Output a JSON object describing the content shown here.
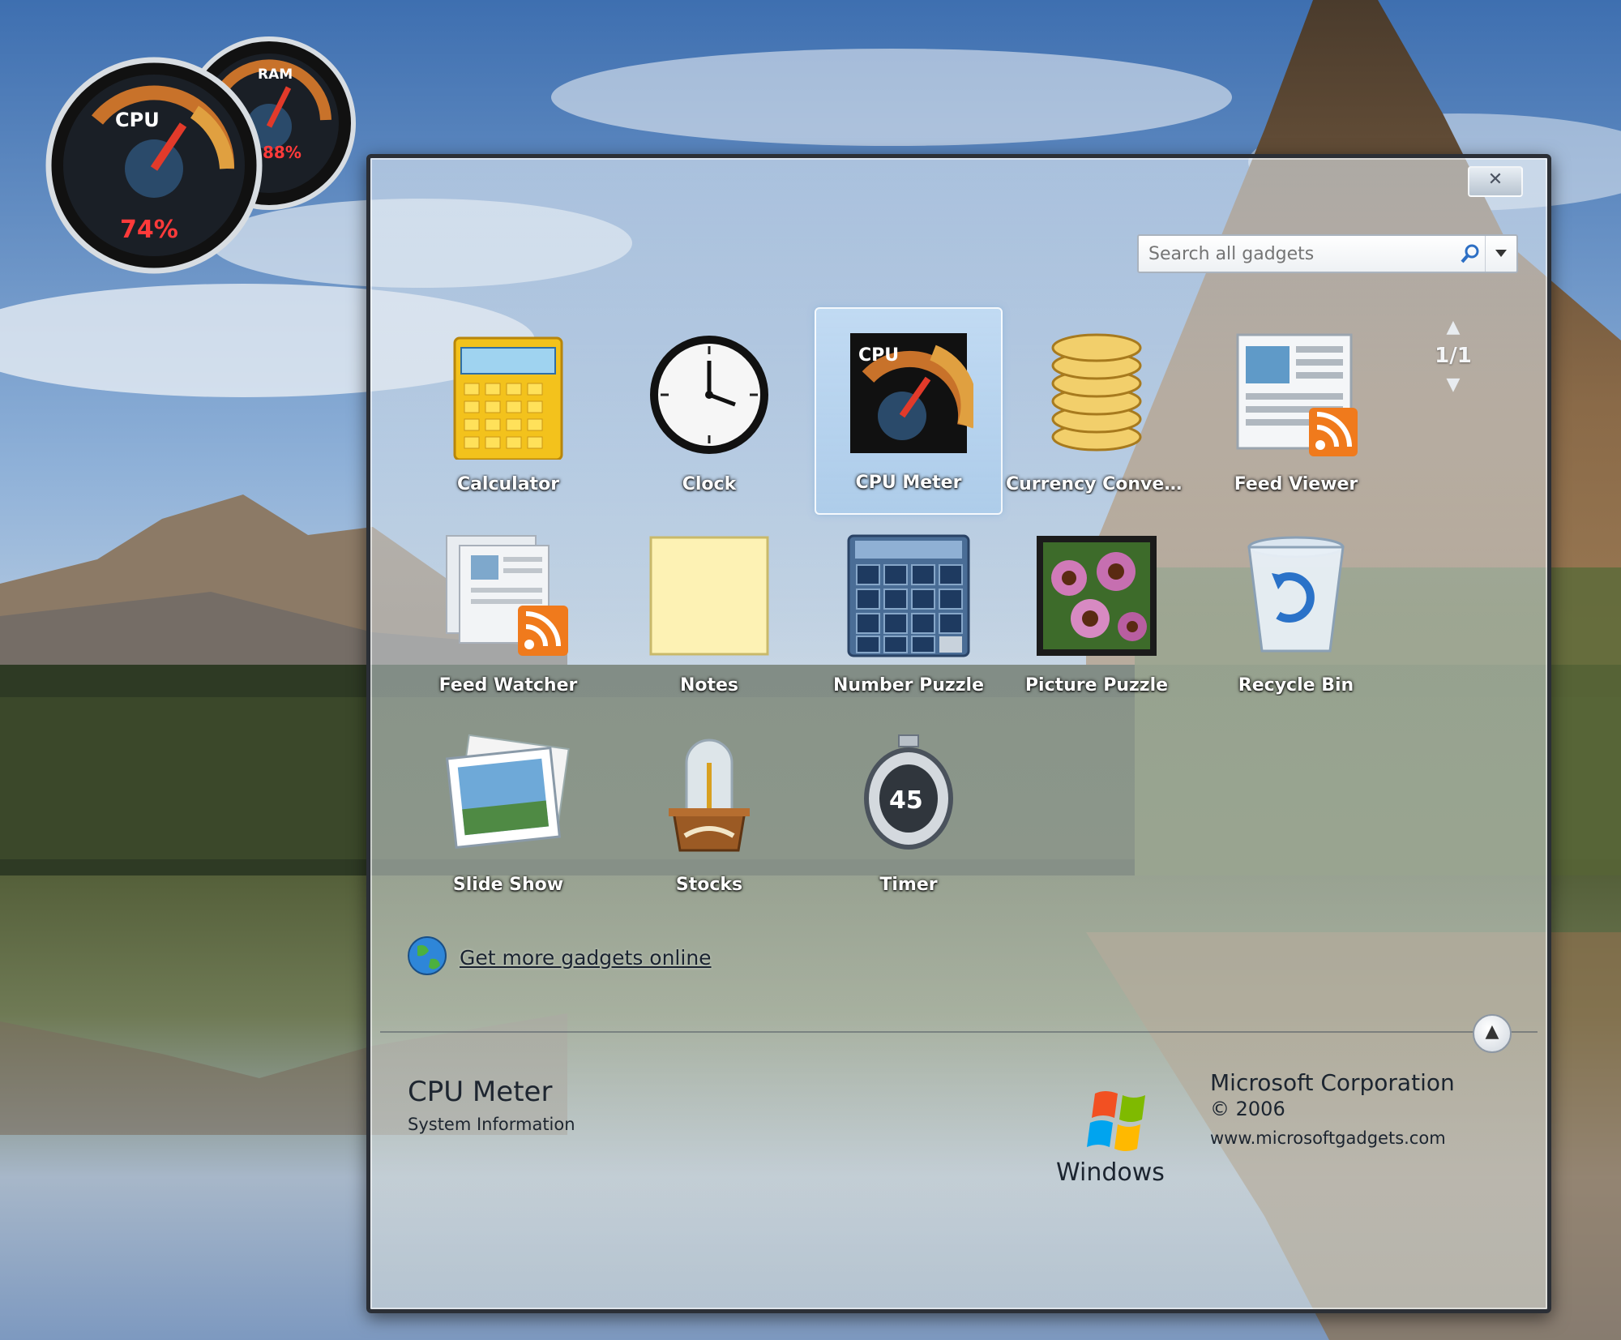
{
  "desktop": {
    "cpu_gadget": {
      "label_large": "CPU",
      "value_large": "74%",
      "label_small": "RAM",
      "value_small": "88%"
    }
  },
  "gallery": {
    "close_label": "✕",
    "search": {
      "placeholder": "Search all gadgets"
    },
    "pager": {
      "text": "1/1",
      "up": "▲",
      "down": "▼"
    },
    "gadgets": [
      {
        "label": "Calculator",
        "icon": "calculator-icon"
      },
      {
        "label": "Clock",
        "icon": "clock-icon"
      },
      {
        "label": "CPU Meter",
        "icon": "cpu-meter-icon",
        "selected": true
      },
      {
        "label": "Currency Conversi...",
        "icon": "currency-icon"
      },
      {
        "label": "Feed Viewer",
        "icon": "feed-viewer-icon"
      },
      {
        "label": "Feed Watcher",
        "icon": "feed-watcher-icon"
      },
      {
        "label": "Notes",
        "icon": "notes-icon"
      },
      {
        "label": "Number Puzzle",
        "icon": "number-puzzle-icon"
      },
      {
        "label": "Picture Puzzle",
        "icon": "picture-puzzle-icon"
      },
      {
        "label": "Recycle Bin",
        "icon": "recycle-bin-icon"
      },
      {
        "label": "Slide Show",
        "icon": "slide-show-icon"
      },
      {
        "label": "Stocks",
        "icon": "stocks-icon"
      },
      {
        "label": "Timer",
        "icon": "timer-icon"
      }
    ],
    "online_link": "Get more gadgets online",
    "collapse_label": "▲",
    "details": {
      "name": "CPU Meter",
      "category": "System Information",
      "logo_text": "Windows",
      "publisher": "Microsoft Corporation",
      "copyright": "© 2006",
      "url": "www.microsoftgadgets.com"
    }
  }
}
